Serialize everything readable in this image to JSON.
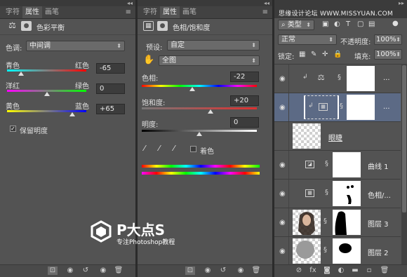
{
  "panel1": {
    "tabs": [
      "字符",
      "属性",
      "画笔"
    ],
    "title": "色彩平衡",
    "tone_label": "色调:",
    "tone_value": "中间调",
    "sliders": [
      {
        "left": "青色",
        "right": "红色",
        "value": "-65",
        "level": 0.175
      },
      {
        "left": "洋红",
        "right": "绿色",
        "value": "0",
        "level": 0.5
      },
      {
        "left": "黄色",
        "right": "蓝色",
        "value": "+65",
        "level": 0.825
      }
    ],
    "preserve_label": "保留明度",
    "preserve_checked": "✓"
  },
  "panel2": {
    "tabs": [
      "字符",
      "属性",
      "画笔"
    ],
    "title": "色相/饱和度",
    "preset_label": "预设:",
    "preset_value": "自定",
    "channel_value": "全图",
    "hue_label": "色相:",
    "hue_value": "-22",
    "hue_level": 0.439,
    "sat_label": "饱和度:",
    "sat_value": "+20",
    "sat_level": 0.6,
    "light_label": "明度:",
    "light_value": "0",
    "light_level": 0.5,
    "colorize_label": "着色"
  },
  "panel3": {
    "watermark": "思缘设计论坛 WWW.MISSYUAN.COM",
    "kind_value": "类型",
    "blend_value": "正常",
    "opacity_label": "不透明度:",
    "opacity_value": "100%",
    "lock_label": "锁定:",
    "fill_label": "填充:",
    "fill_value": "100%",
    "layers": [
      {
        "name": "",
        "icon": "⚖",
        "dots": "..."
      },
      {
        "name": "",
        "icon": "▦",
        "dots": "..."
      },
      {
        "name": "眼睫",
        "icon": "",
        "dots": ""
      },
      {
        "name": "曲线 1",
        "icon": "◪",
        "dots": ""
      },
      {
        "name": "色相/...",
        "icon": "▦",
        "dots": ""
      },
      {
        "name": "图层 3",
        "icon": "",
        "dots": ""
      },
      {
        "name": "图层 2",
        "icon": "",
        "dots": ""
      }
    ]
  },
  "logo": {
    "brand": "P大点S",
    "tagline": "专注Photoshop教程"
  }
}
